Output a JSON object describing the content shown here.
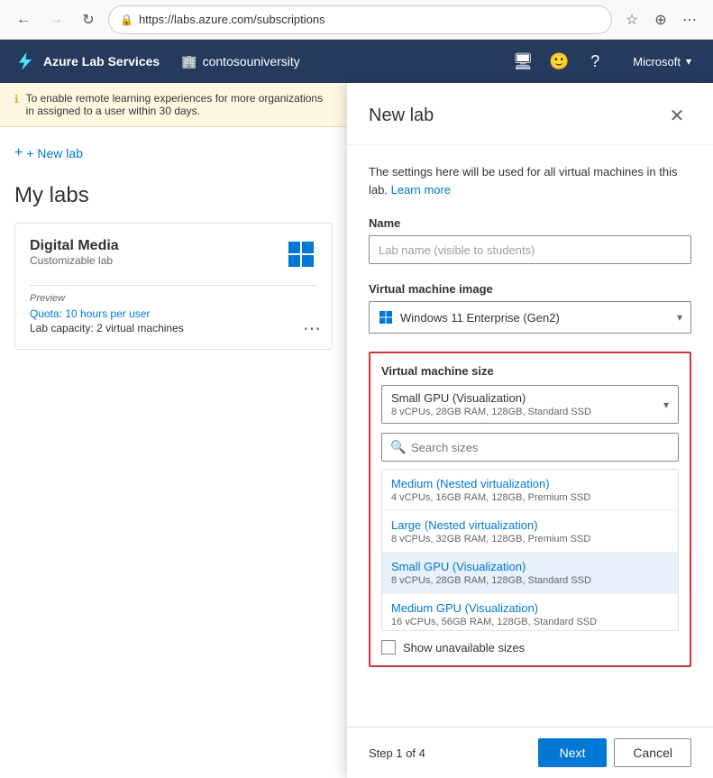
{
  "browser": {
    "url": "https://labs.azure.com/subscriptions",
    "back_disabled": false,
    "forward_disabled": true
  },
  "topbar": {
    "logo_text": "Azure Lab Services",
    "tenant_name": "contosouniversity",
    "account_name": "Microsoft",
    "account_chevron": "▾"
  },
  "left_panel": {
    "banner_text": "To enable remote learning experiences for more organizations in assigned to a user within 30 days.",
    "new_lab_btn": "+ New lab",
    "my_labs_title": "My labs",
    "lab_card": {
      "title": "Digital Media",
      "subtitle": "Customizable lab",
      "status": "Preview",
      "quota_label": "Quota:",
      "quota_value": "10 hours per user",
      "capacity_label": "Lab capacity:",
      "capacity_value": "2 virtual machines"
    }
  },
  "panel": {
    "title": "New lab",
    "desc": "The settings here will be used for all virtual machines in this lab.",
    "learn_more": "Learn more",
    "name_label": "Name",
    "name_placeholder": "Lab name (visible to students)",
    "vm_image_label": "Virtual machine image",
    "vm_image_selected": "Windows 11 Enterprise (Gen2)",
    "vm_size_label": "Virtual machine size",
    "vm_size_selected_name": "Small GPU (Visualization)",
    "vm_size_selected_specs": "8 vCPUs, 28GB RAM, 128GB, Standard SSD",
    "search_placeholder": "Search sizes",
    "sizes": [
      {
        "name": "Medium (Nested virtualization)",
        "specs": "4 vCPUs, 16GB RAM, 128GB, Premium SSD",
        "selected": false
      },
      {
        "name": "Large (Nested virtualization)",
        "specs": "8 vCPUs, 32GB RAM, 128GB, Premium SSD",
        "selected": false
      },
      {
        "name": "Small GPU (Visualization)",
        "specs": "8 vCPUs, 28GB RAM, 128GB, Standard SSD",
        "selected": true
      },
      {
        "name": "Medium GPU (Visualization)",
        "specs": "16 vCPUs, 56GB RAM, 128GB, Standard SSD",
        "selected": false
      }
    ],
    "show_unavailable_label": "Show unavailable sizes",
    "step_text": "Step 1 of 4",
    "next_btn": "Next",
    "cancel_btn": "Cancel"
  }
}
